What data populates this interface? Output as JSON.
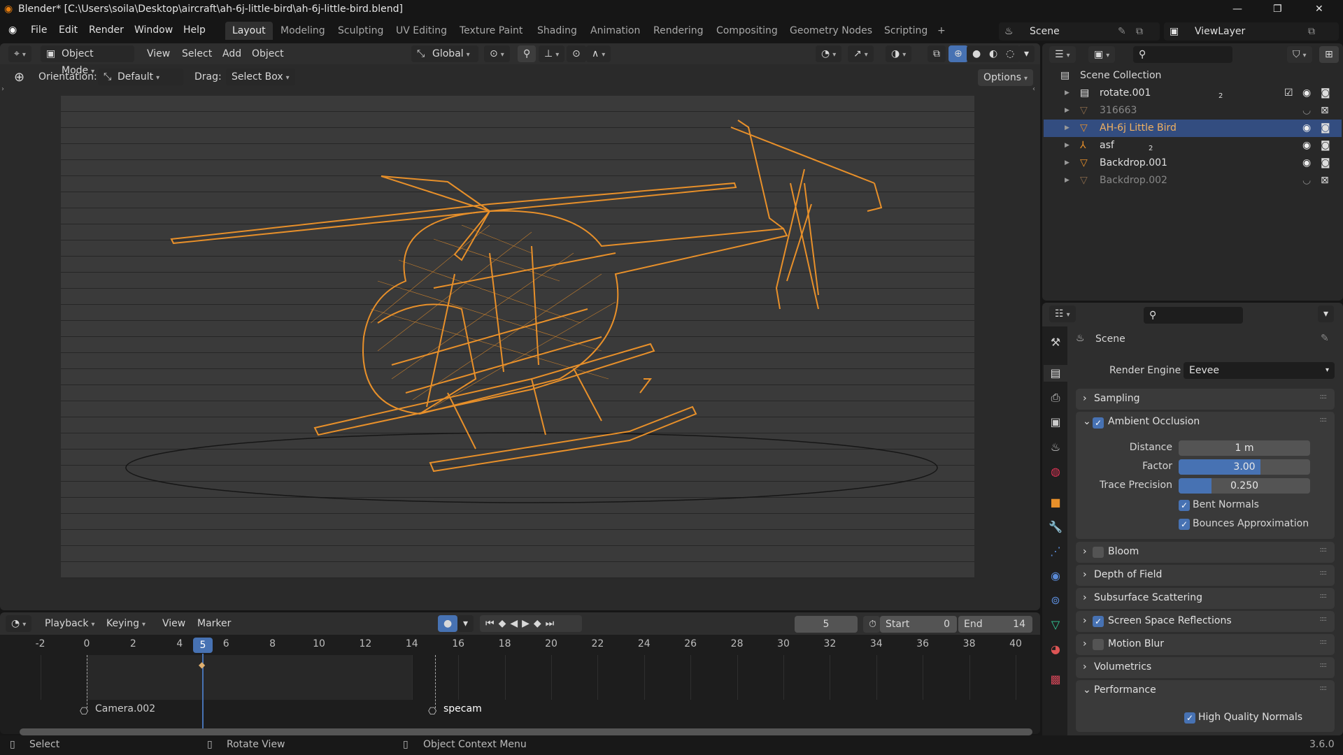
{
  "window": {
    "title": "Blender* [C:\\Users\\soila\\Desktop\\aircraft\\ah-6j-little-bird\\ah-6j-little-bird.blend]",
    "controls": [
      "—",
      "❐",
      "✕"
    ]
  },
  "menu": [
    "File",
    "Edit",
    "Render",
    "Window",
    "Help"
  ],
  "workspaces": [
    "Layout",
    "Modeling",
    "Sculpting",
    "UV Editing",
    "Texture Paint",
    "Shading",
    "Animation",
    "Rendering",
    "Compositing",
    "Geometry Nodes",
    "Scripting",
    "+"
  ],
  "scene_selector": {
    "value": "Scene"
  },
  "viewlayer_selector": {
    "value": "ViewLayer"
  },
  "viewport": {
    "mode": "Object Mode",
    "menus": [
      "View",
      "Select",
      "Add",
      "Object"
    ],
    "transform_orientation": "Global",
    "orientation_label": "Orientation:",
    "orientation_value": "Default",
    "drag_label": "Drag:",
    "drag_value": "Select Box",
    "options": "Options"
  },
  "timeline": {
    "menus": [
      "Playback",
      "Keying",
      "View",
      "Marker"
    ],
    "current_frame": "5",
    "start_label": "Start",
    "start": "0",
    "end_label": "End",
    "end": "14",
    "ticks": [
      -2,
      0,
      2,
      4,
      6,
      8,
      10,
      12,
      14,
      16,
      18,
      20,
      22,
      24,
      26,
      28,
      30,
      32,
      34,
      36,
      38,
      40
    ],
    "frame_start": 0,
    "frame_end": 14,
    "playhead": 5,
    "markers": [
      {
        "name": "Camera.002",
        "frame": 0
      },
      {
        "name": "specam",
        "frame": 15
      }
    ]
  },
  "outliner": {
    "root": "Scene Collection",
    "items": [
      {
        "name": "rotate.001",
        "count": "2",
        "dim": false,
        "selected": false
      },
      {
        "name": "316663",
        "dim": true,
        "selected": false
      },
      {
        "name": "AH-6j Little Bird",
        "dim": false,
        "selected": true
      },
      {
        "name": "asf",
        "count": "2",
        "dim": false,
        "selected": false
      },
      {
        "name": "Backdrop.001",
        "dim": false,
        "selected": false
      },
      {
        "name": "Backdrop.002",
        "dim": true,
        "selected": false
      }
    ]
  },
  "properties": {
    "context": "Scene",
    "render_engine_label": "Render Engine",
    "render_engine": "Eevee",
    "sampling": "Sampling",
    "ao": "Ambient Occlusion",
    "distance_label": "Distance",
    "distance": "1 m",
    "factor_label": "Factor",
    "factor": "3.00",
    "factor_fill": 0.62,
    "trace_label": "Trace Precision",
    "trace": "0.250",
    "trace_fill": 0.25,
    "bent_normals": "Bent Normals",
    "bounces": "Bounces Approximation",
    "panels": [
      {
        "label": "Bloom",
        "checkbox": false
      },
      {
        "label": "Depth of Field"
      },
      {
        "label": "Subsurface Scattering"
      },
      {
        "label": "Screen Space Reflections",
        "checkbox": true
      },
      {
        "label": "Motion Blur",
        "checkbox": false
      },
      {
        "label": "Volumetrics"
      }
    ],
    "performance": "Performance",
    "hq_normals": "High Quality Normals"
  },
  "status": {
    "select": "Select",
    "rotate": "Rotate View",
    "context_menu": "Object Context Menu",
    "version": "3.6.0"
  },
  "colors": {
    "accent": "#4772b3",
    "wire": "#e8902a"
  }
}
